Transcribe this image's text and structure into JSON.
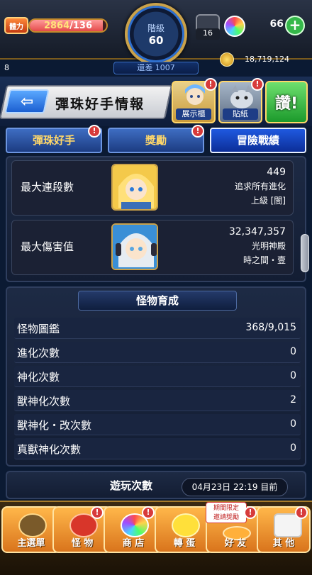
{
  "status_bar": {
    "stamina_label": "體力",
    "stamina_current": "2864",
    "stamina_max": "/136",
    "stamina_fraction": 0.95,
    "rank_label": "階級",
    "rank_value": "60",
    "rank_diff": "還差 1007",
    "box_count": "16",
    "orb_count": "66",
    "orb_add": "+",
    "left_level": "8",
    "coin_count": "18,719,124"
  },
  "header": {
    "title": "彈珠好手情報",
    "back_arrow": "⇦",
    "showcase_label": "展示櫃",
    "sticker_label": "貼紙",
    "like_label": "讚!",
    "notice_mark": "!"
  },
  "tabs": [
    {
      "label": "彈珠好手",
      "active": false,
      "notice": true
    },
    {
      "label": "獎勵",
      "active": false,
      "notice": true
    },
    {
      "label": "冒險戰績",
      "active": true,
      "notice": false
    }
  ],
  "achievements": [
    {
      "label": "最大連段數",
      "lines": [
        "449",
        "追求所有進化",
        "上級 [闇]"
      ]
    },
    {
      "label": "最大傷害值",
      "lines": [
        "32,347,357",
        "光明神殿",
        "時之間・壹"
      ]
    }
  ],
  "monster_section": {
    "title": "怪物育成",
    "rows": [
      {
        "label": "怪物圖鑑",
        "value": "368/9,015"
      },
      {
        "label": "進化次數",
        "value": "0"
      },
      {
        "label": "神化次數",
        "value": "0"
      },
      {
        "label": "獸神化次數",
        "value": "2"
      },
      {
        "label": "獸神化・改次數",
        "value": "0"
      },
      {
        "label": "真獸神化次數",
        "value": "0"
      }
    ]
  },
  "play_section": {
    "title": "遊玩次數",
    "date": "04月23日 22:19 目前"
  },
  "bottom_nav": {
    "items": [
      {
        "label": "主選單",
        "icon": "home-icon",
        "notice": false
      },
      {
        "label": "怪 物",
        "icon": "monster-icon",
        "notice": true
      },
      {
        "label": "商 店",
        "icon": "shop-icon",
        "notice": true
      },
      {
        "label": "轉 蛋",
        "icon": "gacha-icon",
        "notice": false
      },
      {
        "label": "好 友",
        "icon": "friends-icon",
        "notice": true
      },
      {
        "label": "其 他",
        "icon": "other-icon",
        "notice": true
      }
    ],
    "limited_badge_line1": "期間限定",
    "limited_badge_line2": "邀請獎勵"
  },
  "colors": {
    "accent_gold": "#caa24a",
    "tab_active": "#1f59e0",
    "notice_red": "#d73b3b",
    "nav_orange": "#ffb74a"
  }
}
